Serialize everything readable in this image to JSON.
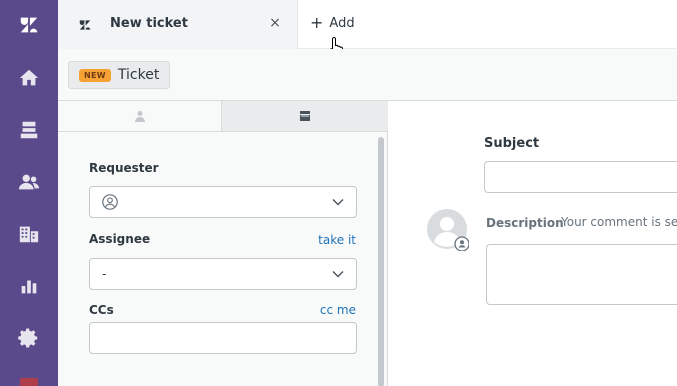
{
  "nav": {
    "items": [
      {
        "icon": "zendesk-logo-icon"
      },
      {
        "icon": "home-icon"
      },
      {
        "icon": "views-icon"
      },
      {
        "icon": "customers-icon"
      },
      {
        "icon": "organizations-icon"
      },
      {
        "icon": "reporting-icon"
      },
      {
        "icon": "admin-gear-icon"
      }
    ],
    "background": "#5b4a8b"
  },
  "tabs": {
    "active_title": "New ticket",
    "close_label": "×",
    "add_label": "Add"
  },
  "ticket_header": {
    "badge": "NEW",
    "label": "Ticket",
    "badge_color": "#f5a133"
  },
  "properties": {
    "requester": {
      "label": "Requester",
      "value": ""
    },
    "assignee": {
      "label": "Assignee",
      "link": "take it",
      "value": "-"
    },
    "ccs": {
      "label": "CCs",
      "link": "cc me",
      "value": ""
    }
  },
  "composer": {
    "subject_label": "Subject",
    "subject_value": "",
    "description_label": "Description",
    "description_note": "Your comment is sent",
    "description_value": ""
  },
  "colors": {
    "link": "#1f73b7",
    "accent": "#5b4a8b"
  }
}
